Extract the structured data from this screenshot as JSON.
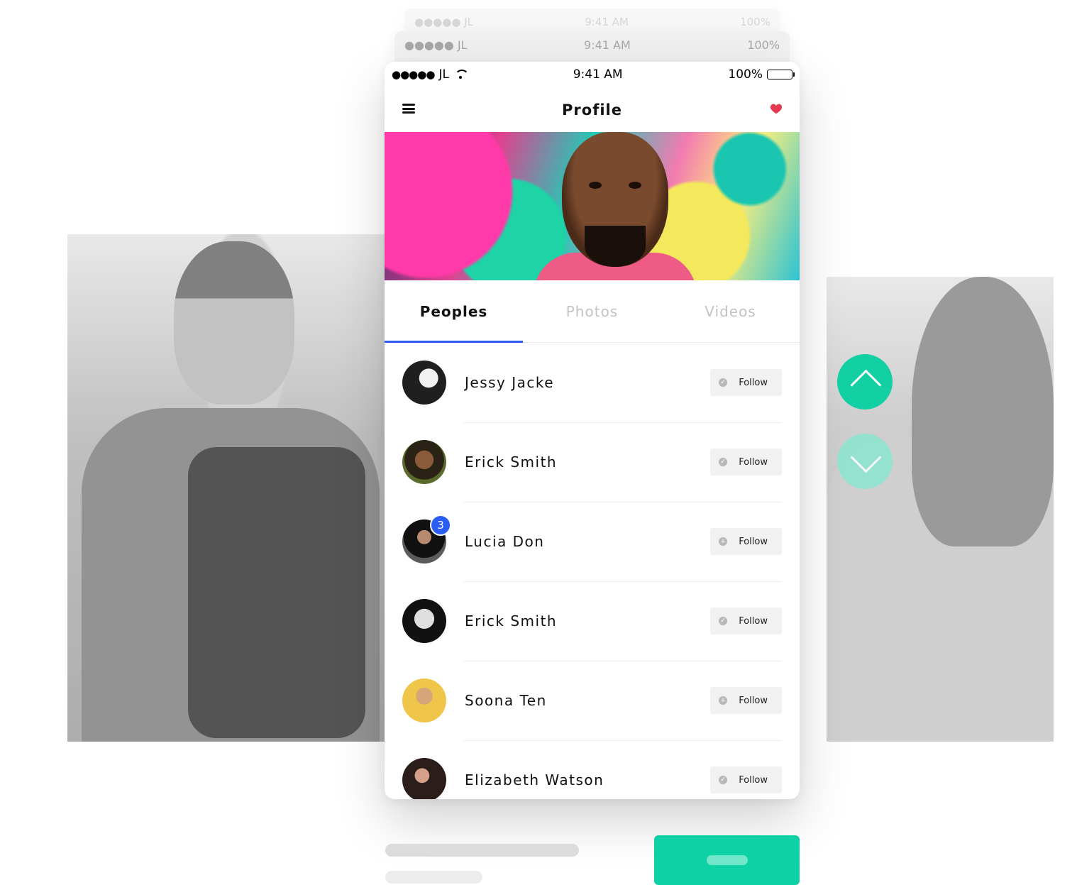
{
  "ghost_status_1": {
    "carrier": "●●●●● JL",
    "time": "9:41 AM",
    "battery": "100%"
  },
  "ghost_status_2": {
    "carrier": "●●●●● JL",
    "time": "9:41 AM",
    "battery": "100%"
  },
  "status_bar": {
    "dots": "●●●●●",
    "carrier": "JL",
    "time": "9:41 AM",
    "battery": "100%"
  },
  "app_bar": {
    "title": "Profile"
  },
  "tabs": [
    {
      "label": "Peoples",
      "active": true
    },
    {
      "label": "Photos",
      "active": false
    },
    {
      "label": "Videos",
      "active": false
    }
  ],
  "people": [
    {
      "name": "Jessy Jacke",
      "follow_label": "Follow"
    },
    {
      "name": "Erick Smith",
      "follow_label": "Follow"
    },
    {
      "name": "Lucia Don",
      "follow_label": "Follow",
      "badge": "3"
    },
    {
      "name": "Erick Smith",
      "follow_label": "Follow"
    },
    {
      "name": "Soona Ten",
      "follow_label": "Follow"
    },
    {
      "name": "Elizabeth Watson",
      "follow_label": "Follow"
    }
  ],
  "colors": {
    "accent_tab": "#2a5df2",
    "cta": "#0fd1a6",
    "heart": "#e53950"
  },
  "icons": {
    "menu": "hamburger-icon",
    "favorite": "heart-icon",
    "scroll_up": "chevron-up-icon",
    "scroll_down": "chevron-down-icon"
  }
}
